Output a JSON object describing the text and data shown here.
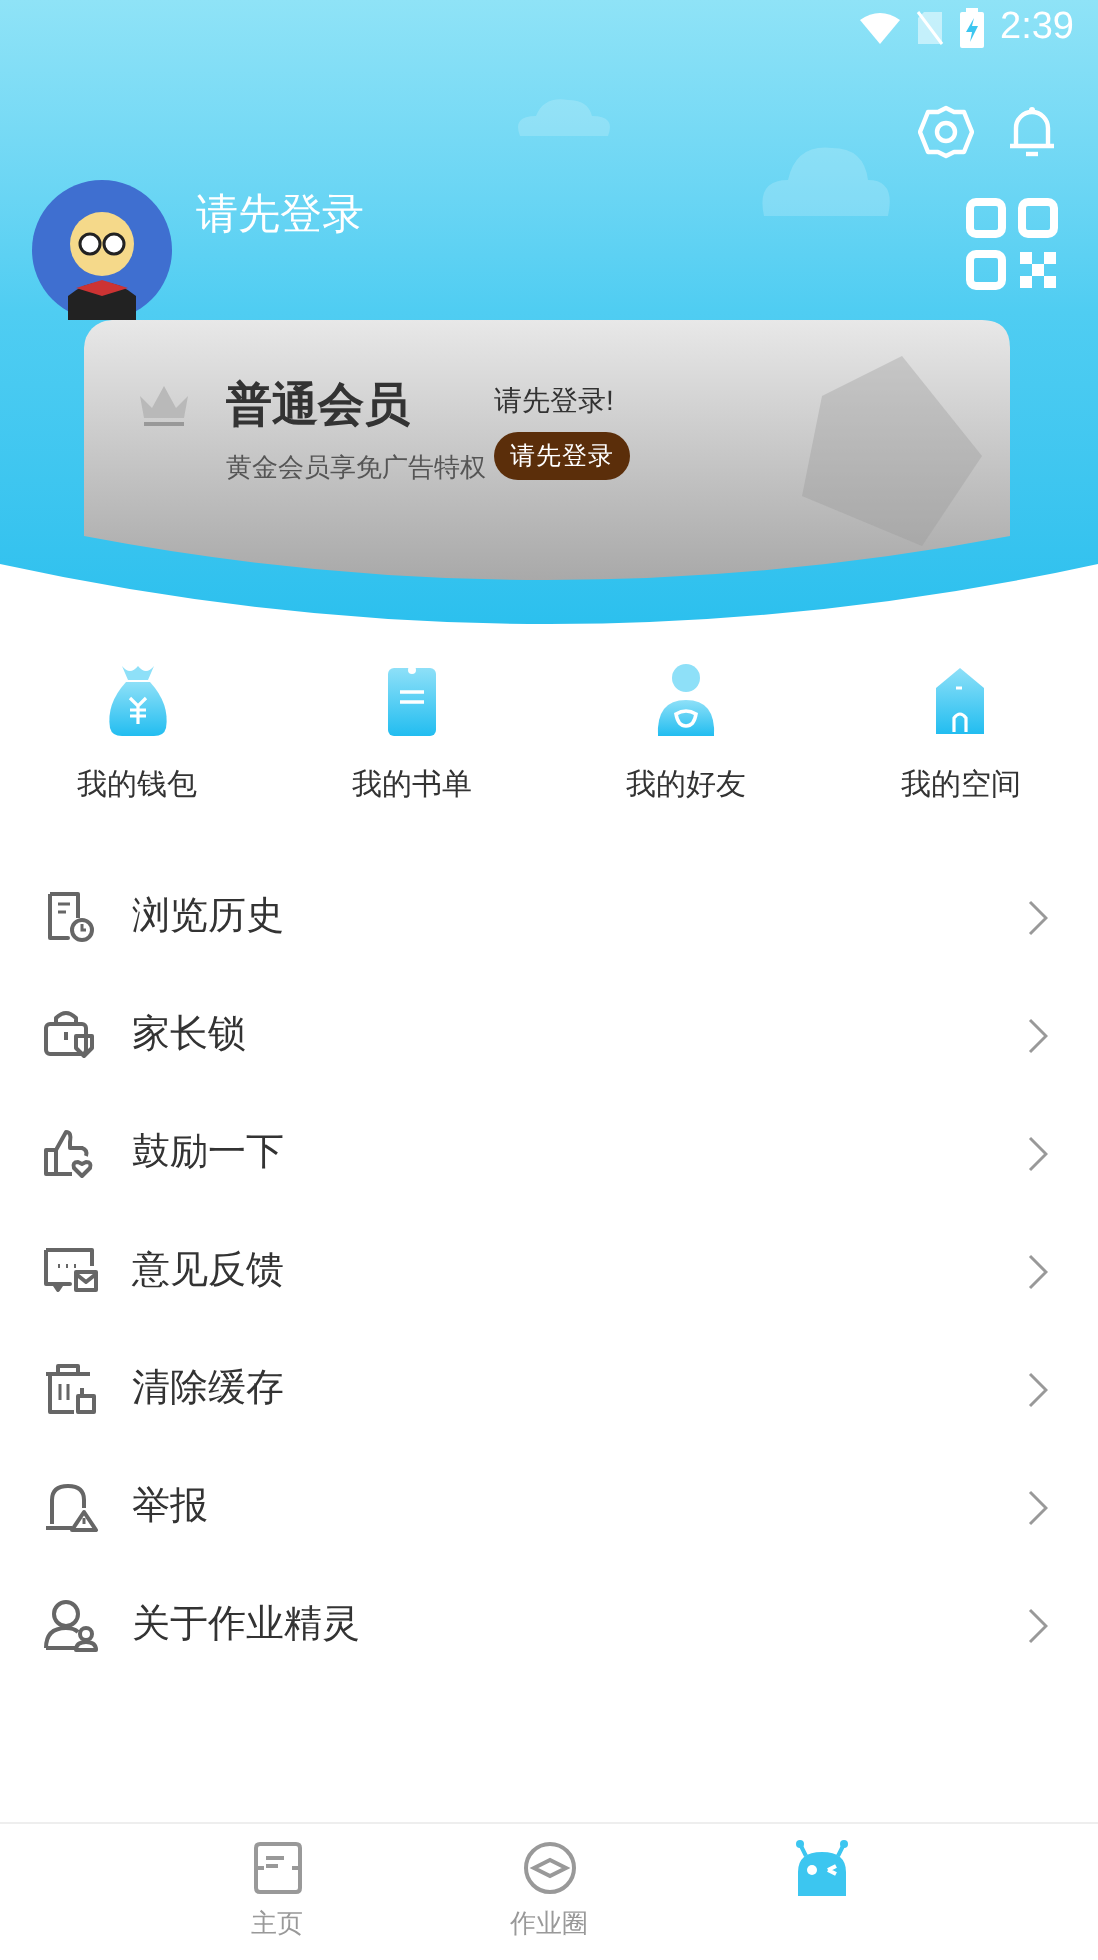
{
  "status_bar": {
    "time": "2:39"
  },
  "profile": {
    "name": "请先登录"
  },
  "membership": {
    "title": "普通会员",
    "subtitle": "黄金会员享免广告特权",
    "prompt": "请先登录!",
    "button": "请先登录"
  },
  "shortcuts": [
    {
      "label": "我的钱包"
    },
    {
      "label": "我的书单"
    },
    {
      "label": "我的好友"
    },
    {
      "label": "我的空间"
    }
  ],
  "menu": [
    {
      "label": "浏览历史"
    },
    {
      "label": "家长锁"
    },
    {
      "label": "鼓励一下"
    },
    {
      "label": "意见反馈"
    },
    {
      "label": "清除缓存"
    },
    {
      "label": "举报"
    },
    {
      "label": "关于作业精灵"
    }
  ],
  "tabs": [
    {
      "label": "主页",
      "selected": false
    },
    {
      "label": "作业圈",
      "selected": false
    },
    {
      "selected": true
    }
  ]
}
